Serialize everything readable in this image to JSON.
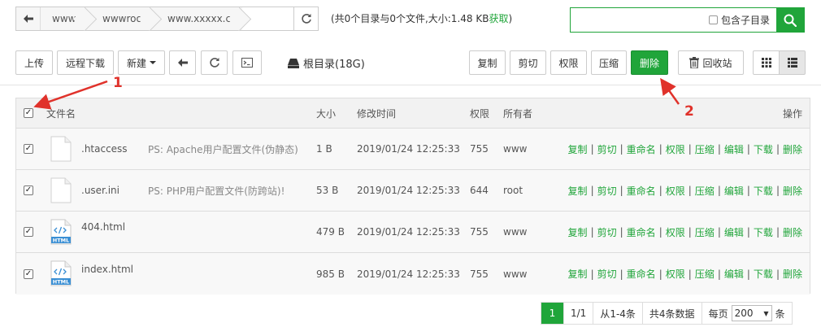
{
  "path": {
    "crumbs": [
      "www",
      "wwwroot",
      "www.xxxxx.com"
    ]
  },
  "dir_info": {
    "text": "(共0个目录与0个文件,大小:1.48 KB",
    "fetch_label": "获取",
    "close": ")"
  },
  "search": {
    "placeholder": "",
    "subdir_label": "包含子目录"
  },
  "toolbar": {
    "upload": "上传",
    "remote_download": "远程下载",
    "new": "新建",
    "root_dir": "根目录(18G)",
    "copy": "复制",
    "cut": "剪切",
    "permission": "权限",
    "compress": "压缩",
    "delete": "删除",
    "recycle_bin": "回收站"
  },
  "table": {
    "headers": {
      "name": "文件名",
      "size": "大小",
      "mtime": "修改时间",
      "perm": "权限",
      "owner": "所有者",
      "ops": "操作"
    },
    "rows": [
      {
        "name": ".htaccess",
        "ps": "PS: Apache用户配置文件(伪静态)",
        "size": "1 B",
        "mtime": "2019/01/24 12:25:33",
        "perm": "755",
        "owner": "www",
        "icon": "file-icon"
      },
      {
        "name": ".user.ini",
        "ps": "PS: PHP用户配置文件(防跨站)!",
        "size": "53 B",
        "mtime": "2019/01/24 12:25:33",
        "perm": "644",
        "owner": "root",
        "icon": "file-icon"
      },
      {
        "name": "404.html",
        "ps": "",
        "size": "479 B",
        "mtime": "2019/01/24 12:25:33",
        "perm": "755",
        "owner": "www",
        "icon": "html-file-icon"
      },
      {
        "name": "index.html",
        "ps": "",
        "size": "985 B",
        "mtime": "2019/01/24 12:25:33",
        "perm": "755",
        "owner": "www",
        "icon": "html-file-icon"
      }
    ],
    "ops": [
      "复制",
      "剪切",
      "重命名",
      "权限",
      "压缩",
      "编辑",
      "下载",
      "删除"
    ],
    "html_badge": "HTML"
  },
  "pagination": {
    "current": "1",
    "pages": "1/1",
    "range": "从1-4条",
    "total": "共4条数据",
    "per_page_label": "每页",
    "per_page_value": "200",
    "per_page_unit": "条"
  },
  "annotations": [
    "1",
    "2"
  ],
  "colors": {
    "accent": "#20a53a",
    "annotation": "#e0322b"
  }
}
